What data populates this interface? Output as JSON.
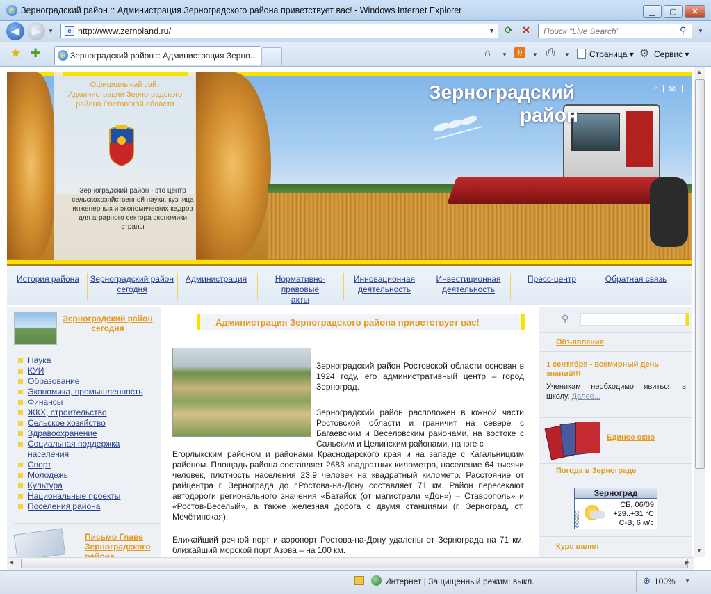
{
  "window": {
    "title": "Зерноградский район :: Администрация Зерноградского района приветствует вас! - Windows Internet Explorer"
  },
  "browser": {
    "address": "http://www.zernoland.ru/",
    "search_placeholder": "Поиск \"Live Search\"",
    "tab_title": "Зерноградский район :: Администрация Зерно...",
    "toolbar": {
      "page": "Страница",
      "tools": "Сервис"
    }
  },
  "header": {
    "slogan": "Официальный сайт Администрации Зерноградского района Ростовской области",
    "description": "Зерноградский район - это центр сельскохозяйственной науки, кузница инженерных и экономических кадров для аграрного сектора экономики страны",
    "title_line1": "Зерноградский",
    "title_line2": "район"
  },
  "nav": [
    {
      "l1": "История района",
      "l2": "",
      "l3": ""
    },
    {
      "l1": "Зерноградский район",
      "l2": "сегодня",
      "l3": ""
    },
    {
      "l1": "Администрация",
      "l2": "",
      "l3": ""
    },
    {
      "l1": "Нормативно-",
      "l2": "правовые",
      "l3": "акты"
    },
    {
      "l1": "Инновационная",
      "l2": "деятельность",
      "l3": ""
    },
    {
      "l1": "Инвестиционная",
      "l2": "деятельность",
      "l3": ""
    },
    {
      "l1": "Пресс-центр",
      "l2": "",
      "l3": ""
    },
    {
      "l1": "Обратная связь",
      "l2": "",
      "l3": ""
    }
  ],
  "sidebar": {
    "today_l1": "Зерноградский район",
    "today_l2": "сегодня",
    "items": [
      "Наука",
      "КУИ",
      "Образование",
      "Экономика, промышленность",
      "Финансы",
      "ЖКХ, строительство",
      "Сельское хозяйство",
      "Здравоохранение",
      "Социальная поддержка",
      "населения",
      "Спорт",
      "Молодежь",
      "Культура",
      "Национальные проекты",
      "Поселения района"
    ],
    "letter_l1": "Письмо Главе",
    "letter_l2": "Зерноградского",
    "letter_l3": "района"
  },
  "main": {
    "heading": "Администрация Зерноградского района приветствует вас!",
    "p1": "Зерноградский район Ростовской области основан в 1924 году, его административный центр – город Зерноград.",
    "p2a": "Зерноградский район расположен в южной части Ростовской области и граничит на севере с Багаевским и Веселовским районами, на востоке с Сальским и Целинским районами, на юге с",
    "p2b": "Егорлыкским районом и районами Краснодарского края и на западе с Кагальницким районом. Площадь района составляет 2683 квадратных километра, население 64 тысячи человек, плотность населения 23,9 человек на квадратный километр. Расстояние от райцентра г. Зернограда до г.Ростова-на-Дону составляет 71 км. Район пересекают автодороги регионального значения «Батайск (от магистрали «Дон») – Ставрополь» и «Ростов-Веселый», а также железная дорога с двумя станциями (г. Зерноград, ст. Мечётинская).",
    "p3": "Ближайший речной порт и аэропорт Ростова-на-Дону удалены от Зернограда на 71 км, ближайший морской порт Азова – на 100 км."
  },
  "right": {
    "announcements": "Объявления",
    "news_title": "1 сентября - всемирный день знаний!!!",
    "news_text": "Ученикам необходимо явиться в школу.",
    "more": "Далее...",
    "one_window": "Единое окно",
    "weather_title": "Погода в Зернограде",
    "weather": {
      "city": "Зерноград",
      "date": "СБ, 06/09",
      "temp": "+29..+31 °С",
      "wind": "С-В, 6 м/с",
      "brand": "ФОБОС"
    },
    "currency": "Курс валют"
  },
  "status": {
    "zone": "Интернет | Защищенный режим: выкл.",
    "zoom": "100%"
  }
}
